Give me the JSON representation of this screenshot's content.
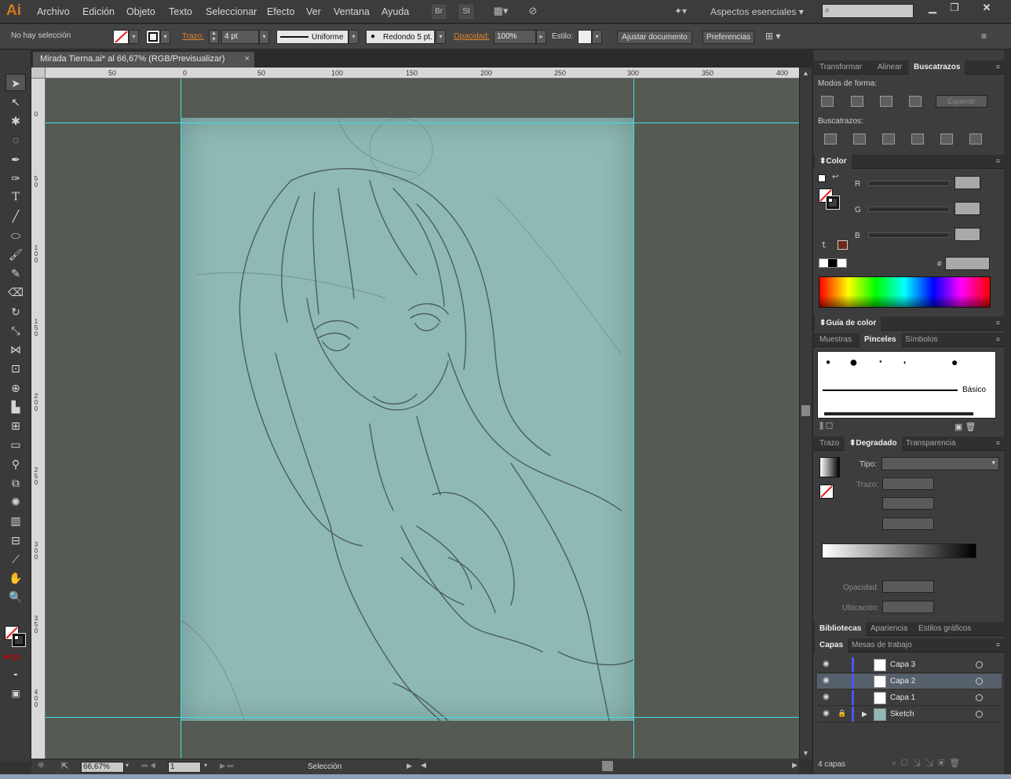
{
  "app": {
    "logo": "Ai"
  },
  "menu": [
    "Archivo",
    "Edición",
    "Objeto",
    "Texto",
    "Seleccionar",
    "Efecto",
    "Ver",
    "Ventana",
    "Ayuda"
  ],
  "menu_buttons": {
    "bridge": "Br",
    "stock": "St"
  },
  "workspace": "Aspectos esenciales",
  "control": {
    "selection": "No hay selección",
    "stroke_label": "Trazo:",
    "stroke_value": "4 pt",
    "profile": "Uniforme",
    "brush": "Redondo 5 pt.",
    "opacity_label": "Opacidad:",
    "opacity_value": "100%",
    "style_label": "Estilo:",
    "fit_button": "Ajustar documento",
    "prefs_button": "Preferencias"
  },
  "document": {
    "tab_title": "Mirada Tierna.ai* al 66,67% (RGB/Previsualizar)",
    "close": "×"
  },
  "ruler_h": [
    "50",
    "0",
    "50",
    "100",
    "150",
    "200",
    "250",
    "300",
    "350",
    "400"
  ],
  "ruler_v": [
    "0",
    "50",
    "100",
    "150",
    "200",
    "250",
    "300",
    "350",
    "400"
  ],
  "status": {
    "zoom": "66,67%",
    "artboard": "1",
    "tool": "Selección"
  },
  "panels": {
    "pathfinder": {
      "tabs": [
        "Transformar",
        "Alinear",
        "Buscatrazos"
      ],
      "shape_modes": "Modos de forma:",
      "expand": "Expandir",
      "pathfinders": "Buscatrazos:"
    },
    "color": {
      "title": "Color",
      "r": "R",
      "g": "G",
      "b": "B",
      "hash": "#"
    },
    "guide": {
      "title": "Guía de color"
    },
    "brushes": {
      "tabs": [
        "Muestras",
        "Pinceles",
        "Símbolos"
      ],
      "basic": "Básico"
    },
    "gradient": {
      "tabs": [
        "Trazo",
        "Degradado",
        "Transparencia"
      ],
      "type_label": "Tipo:",
      "stroke_label": "Trazo:",
      "opacity_label": "Opacidad:",
      "location_label": "Ubicación:"
    },
    "libraries": {
      "tabs": [
        "Bibliotecas",
        "Apariencia",
        "Estilos gráficos"
      ]
    },
    "layers": {
      "tabs": [
        "Capas",
        "Mesas de trabajo"
      ],
      "rows": [
        "Capa 3",
        "Capa 2",
        "Capa 1",
        "Sketch"
      ],
      "count": "4 capas"
    }
  },
  "colors": {
    "accent": "#d2781f",
    "guide": "#3ee0e0",
    "artboard": "#8fb9b4"
  }
}
